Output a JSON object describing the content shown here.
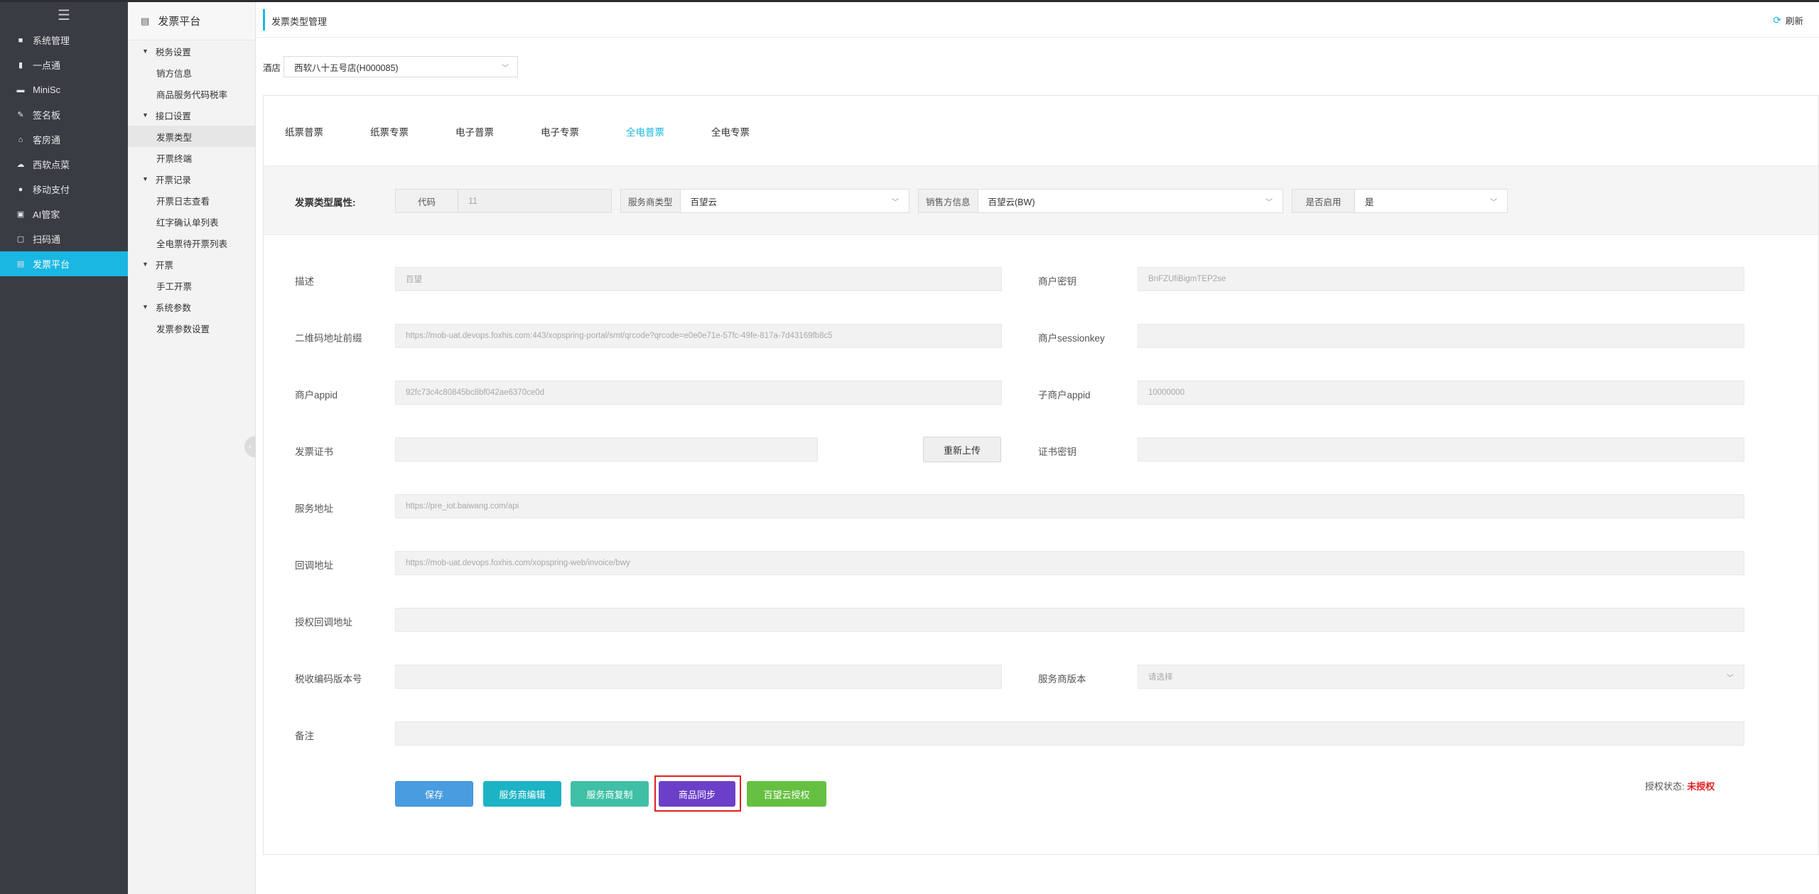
{
  "nav": {
    "items": [
      {
        "label": "系统管理",
        "icon": "grid-icon",
        "glyph": "■"
      },
      {
        "label": "一点通",
        "icon": "bar-chart-icon",
        "glyph": "▮"
      },
      {
        "label": "MiniSc",
        "icon": "mini-icon",
        "glyph": "▬"
      },
      {
        "label": "签名板",
        "icon": "pen-icon",
        "glyph": "✎"
      },
      {
        "label": "客房通",
        "icon": "home-icon",
        "glyph": "⌂"
      },
      {
        "label": "西软点菜",
        "icon": "cloud-icon",
        "glyph": "☁"
      },
      {
        "label": "移动支付",
        "icon": "pay-icon",
        "glyph": "●"
      },
      {
        "label": "AI管家",
        "icon": "lock-icon",
        "glyph": "▣"
      },
      {
        "label": "扫码通",
        "icon": "scan-icon",
        "glyph": "▢"
      },
      {
        "label": "发票平台",
        "icon": "invoice-icon",
        "glyph": "▤"
      }
    ]
  },
  "submenu": {
    "title": "发票平台",
    "groups": [
      {
        "label": "税务设置",
        "items": [
          "销方信息",
          "商品服务代码税率"
        ]
      },
      {
        "label": "接口设置",
        "items": [
          "发票类型",
          "开票终端"
        ]
      },
      {
        "label": "开票记录",
        "items": [
          "开票日志查看",
          "红字确认单列表",
          "全电票待开票列表"
        ]
      },
      {
        "label": "开票",
        "items": [
          "手工开票"
        ]
      },
      {
        "label": "系统参数",
        "items": [
          "发票参数设置"
        ]
      }
    ]
  },
  "page": {
    "title": "发票类型管理",
    "refresh": "刷新",
    "hotel_label": "酒店",
    "hotel_value": "西软八十五号店(H000085)"
  },
  "tabs": [
    "纸票普票",
    "纸票专票",
    "电子普票",
    "电子专票",
    "全电普票",
    "全电专票"
  ],
  "attrs": {
    "heading": "发票类型属性:",
    "code_label": "代码",
    "code_value": "11",
    "provider_type_label": "服务商类型",
    "provider_type_value": "百望云",
    "seller_label": "销售方信息",
    "seller_value": "百望云(BW)",
    "enabled_label": "是否启用",
    "enabled_value": "是"
  },
  "form": {
    "desc_label": "描述",
    "desc_value": "百望",
    "secret_label": "商户密钥",
    "secret_value": "BnFZUfiBigmTEP2se",
    "qr_label": "二维码地址前缀",
    "qr_value": "https://mob-uat.devops.foxhis.com:443/xopspring-portal/smt/qrcode?qrcode=e0e0e71e-57fc-49fe-817a-7d43169fb8c5",
    "sessionkey_label": "商户sessionkey",
    "sessionkey_value": "",
    "appid_label": "商户appid",
    "appid_value": "92fc73c4c80845bc8bf042ae6370ce0d",
    "sub_appid_label": "子商户appid",
    "sub_appid_value": "10000000",
    "cert_label": "发票证书",
    "cert_value": "",
    "reupload_label": "重新上传",
    "cert_secret_label": "证书密钥",
    "cert_secret_value": "",
    "service_url_label": "服务地址",
    "service_url_value": "https://pre_iot.baiwang.com/api",
    "callback_label": "回调地址",
    "callback_value": "https://mob-uat.devops.foxhis.com/xopspring-web/invoice/bwy",
    "auth_callback_label": "授权回调地址",
    "auth_callback_value": "",
    "tax_code_ver_label": "税收编码版本号",
    "tax_code_ver_value": "",
    "provider_ver_label": "服务商版本",
    "provider_ver_placeholder": "请选择",
    "remark_label": "备注",
    "remark_value": ""
  },
  "buttons": {
    "save": "保存",
    "provider_edit": "服务商编辑",
    "provider_copy": "服务商复制",
    "goods_sync": "商品同步",
    "baiwang_auth": "百望云授权"
  },
  "auth": {
    "label": "授权状态:",
    "value": "未授权"
  },
  "colors": {
    "accent": "#1ab7e2",
    "nav_bg": "#3a3c43",
    "warn": "#e02020"
  }
}
